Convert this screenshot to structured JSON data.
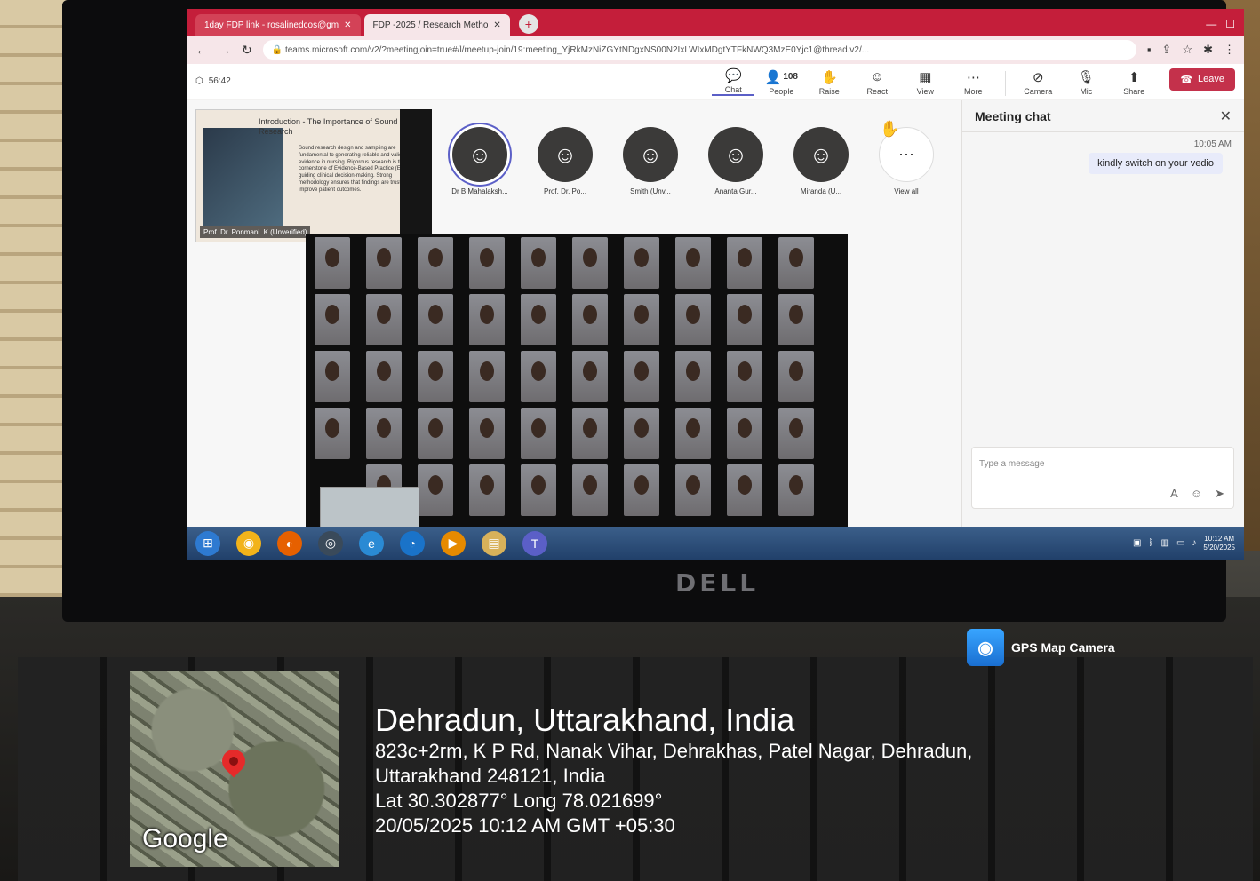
{
  "browser": {
    "tabs": [
      {
        "label": "1day FDP link - rosalinedcos@gm",
        "active": false
      },
      {
        "label": "FDP -2025 / Research Metho",
        "active": true
      }
    ],
    "url": "teams.microsoft.com/v2/?meetingjoin=true#/l/meetup-join/19:meeting_YjRkMzNiZGYtNDgxNS00N2IxLWIxMDgtYTFkNWQ3MzE0Yjc1@thread.v2/..."
  },
  "meeting": {
    "timer": "56:42",
    "controls": {
      "chat": "Chat",
      "people": "People",
      "people_count": "108",
      "raise": "Raise",
      "react": "React",
      "view": "View",
      "more": "More",
      "camera": "Camera",
      "mic": "Mic",
      "share": "Share",
      "leave": "Leave"
    },
    "slide": {
      "title": "Introduction - The Importance of Sound Research",
      "text": "Sound research design and sampling are fundamental to generating reliable and valid evidence in nursing. Rigorous research is the cornerstone of Evidence-Based Practice (EBP), guiding clinical decision-making. Strong methodology ensures that findings are trustworthy to improve patient outcomes.",
      "presenter": "Prof. Dr. Ponmani. K (Unverified)"
    },
    "participants": [
      {
        "name": "Dr B Mahalaksh..."
      },
      {
        "name": "Prof. Dr. Po..."
      },
      {
        "name": "Smith (Unv..."
      },
      {
        "name": "Ananta Gur..."
      },
      {
        "name": "Miranda (U..."
      }
    ],
    "view_all": "View all"
  },
  "chat": {
    "title": "Meeting chat",
    "time": "10:05 AM",
    "message": "kindly switch on your vedio",
    "placeholder": "Type a message"
  },
  "taskbar": {
    "time": "10:12 AM",
    "date": "5/20/2025"
  },
  "device": {
    "brand": "DELL"
  },
  "gps": {
    "app": "GPS Map Camera",
    "map_label": "Google",
    "city": "Dehradun, Uttarakhand, India",
    "address_line1": "823c+2rm, K P Rd, Nanak Vihar, Dehrakhas, Patel Nagar, Dehradun,",
    "address_line2": "Uttarakhand 248121, India",
    "coords": "Lat 30.302877° Long 78.021699°",
    "datetime": "20/05/2025 10:12 AM GMT +05:30"
  },
  "colors": {
    "teams_accent": "#5b5fc7",
    "leave": "#c4314b",
    "tab_bar": "#c41e3a"
  }
}
